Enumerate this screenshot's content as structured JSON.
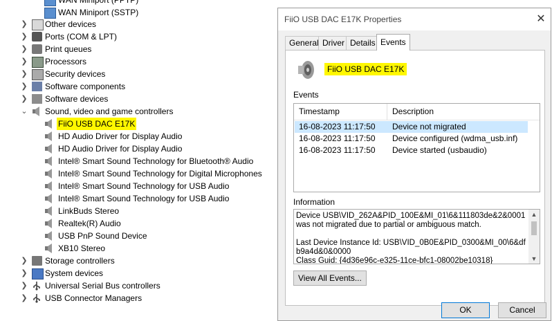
{
  "tree": {
    "top_items": [
      {
        "label": "WAN Miniport (PPTP)",
        "icon": "network-adapter-icon"
      },
      {
        "label": "WAN Miniport (SSTP)",
        "icon": "network-adapter-icon"
      }
    ],
    "categories_before": [
      {
        "label": "Other devices",
        "icon": "other-devices-icon"
      },
      {
        "label": "Ports (COM & LPT)",
        "icon": "ports-icon"
      },
      {
        "label": "Print queues",
        "icon": "printer-icon"
      },
      {
        "label": "Processors",
        "icon": "processor-icon"
      },
      {
        "label": "Security devices",
        "icon": "security-device-icon"
      },
      {
        "label": "Software components",
        "icon": "software-component-icon"
      },
      {
        "label": "Software devices",
        "icon": "software-device-icon"
      }
    ],
    "sound_category": {
      "label": "Sound, video and game controllers",
      "icon": "speaker-icon",
      "expanded": true
    },
    "sound_children": [
      {
        "label": "FiiO USB DAC E17K",
        "highlighted": true
      },
      {
        "label": "HD Audio Driver for Display Audio"
      },
      {
        "label": "HD Audio Driver for Display Audio"
      },
      {
        "label": "Intel® Smart Sound Technology for Bluetooth® Audio"
      },
      {
        "label": "Intel® Smart Sound Technology for Digital Microphones"
      },
      {
        "label": "Intel® Smart Sound Technology for USB Audio"
      },
      {
        "label": "Intel® Smart Sound Technology for USB Audio"
      },
      {
        "label": "LinkBuds Stereo"
      },
      {
        "label": "Realtek(R) Audio"
      },
      {
        "label": "USB PnP Sound Device"
      },
      {
        "label": "XB10 Stereo"
      }
    ],
    "categories_after": [
      {
        "label": "Storage controllers",
        "icon": "storage-controller-icon"
      },
      {
        "label": "System devices",
        "icon": "system-device-icon"
      },
      {
        "label": "Universal Serial Bus controllers",
        "icon": "usb-icon"
      },
      {
        "label": "USB Connector Managers",
        "icon": "usb-icon"
      }
    ]
  },
  "dialog": {
    "title": "FiiO USB DAC E17K Properties",
    "tabs": [
      {
        "label": "General",
        "active": false
      },
      {
        "label": "Driver",
        "active": false
      },
      {
        "label": "Details",
        "active": false
      },
      {
        "label": "Events",
        "active": true
      }
    ],
    "device_name": "FiiO USB DAC E17K",
    "events_label": "Events",
    "events_table": {
      "headers": [
        "Timestamp",
        "Description"
      ],
      "rows": [
        {
          "timestamp": "16-08-2023 11:17:50",
          "description": "Device not migrated",
          "selected": true
        },
        {
          "timestamp": "16-08-2023 11:17:50",
          "description": "Device configured (wdma_usb.inf)",
          "selected": false
        },
        {
          "timestamp": "16-08-2023 11:17:50",
          "description": "Device started (usbaudio)",
          "selected": false
        }
      ]
    },
    "information_label": "Information",
    "information_text": "Device USB\\VID_262A&PID_100E&MI_01\\6&111803de&2&0001 was not migrated due to partial or ambiguous match.\n\nLast Device Instance Id: USB\\VID_0B0E&PID_0300&MI_00\\6&dfb9a4d&0&0000\nClass Guid: {4d36e96c-e325-11ce-bfc1-08002be10318}",
    "view_all_events_label": "View All Events...",
    "ok_label": "OK",
    "cancel_label": "Cancel",
    "close_glyph": "✕"
  },
  "colors": {
    "highlight": "#fff700",
    "selection": "#cce8ff",
    "dialog_bg": "#f0f0f0"
  }
}
